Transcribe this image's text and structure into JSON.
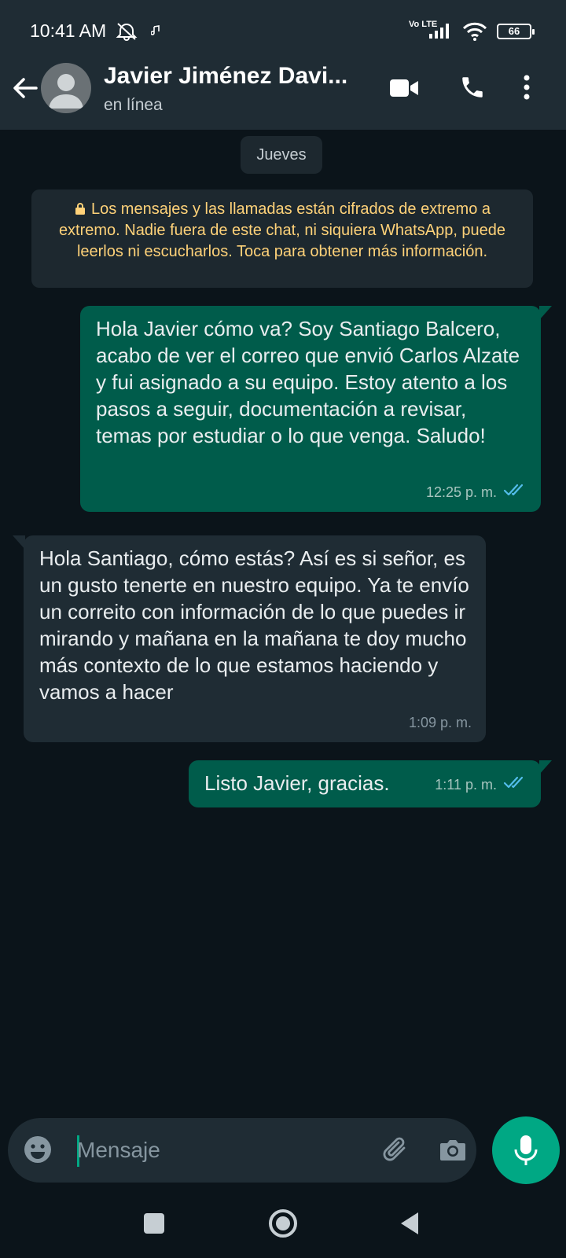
{
  "status_bar": {
    "time": "10:41 AM",
    "network_label": "Vo LTE",
    "battery": "66",
    "icons": [
      "alarm-off-icon",
      "music-icon",
      "signal-icon",
      "wifi-icon",
      "battery-icon"
    ]
  },
  "header": {
    "contact_name": "Javier Jiménez Davi...",
    "status": "en línea",
    "icons": [
      "back-arrow-icon",
      "avatar-icon",
      "video-call-icon",
      "phone-icon",
      "more-vert-icon"
    ]
  },
  "chat": {
    "date_chip": "Jueves",
    "encryption_notice": "Los mensajes y las llamadas están cifrados de extremo a extremo. Nadie fuera de este chat, ni siquiera WhatsApp, puede leerlos ni escucharlos. Toca para obtener más información.",
    "messages": [
      {
        "direction": "out",
        "text": "Hola Javier cómo va? Soy Santiago Balcero, acabo de ver el correo que envió Carlos Alzate y fui asignado a su equipo. Estoy atento a los pasos a seguir, documentación a revisar, temas por estudiar o lo que venga. Saludo!",
        "time": "12:25 p. m.",
        "read": true
      },
      {
        "direction": "in",
        "text": "Hola Santiago, cómo estás? Así es si señor, es un gusto tenerte en nuestro equipo. Ya te envío un correito con información de lo que puedes ir mirando y mañana en la mañana te doy mucho más contexto de lo que estamos haciendo y vamos a hacer",
        "time": "1:09 p. m.",
        "read": false
      },
      {
        "direction": "out",
        "text": "Listo Javier, gracias.",
        "time": "1:11 p. m.",
        "read": true
      }
    ]
  },
  "composer": {
    "placeholder": "Mensaje",
    "icons": [
      "emoji-icon",
      "attach-icon",
      "camera-icon",
      "mic-icon"
    ]
  },
  "navbar": {
    "icons": [
      "recents-square-icon",
      "home-circle-icon",
      "back-triangle-icon"
    ]
  },
  "colors": {
    "header_bg": "#1f2c34",
    "chat_bg": "#0b141a",
    "outgoing_bubble": "#005c4b",
    "incoming_bubble": "#1f2c34",
    "notice_text": "#ffd279",
    "accent": "#00a884",
    "read_tick": "#53bdeb"
  }
}
